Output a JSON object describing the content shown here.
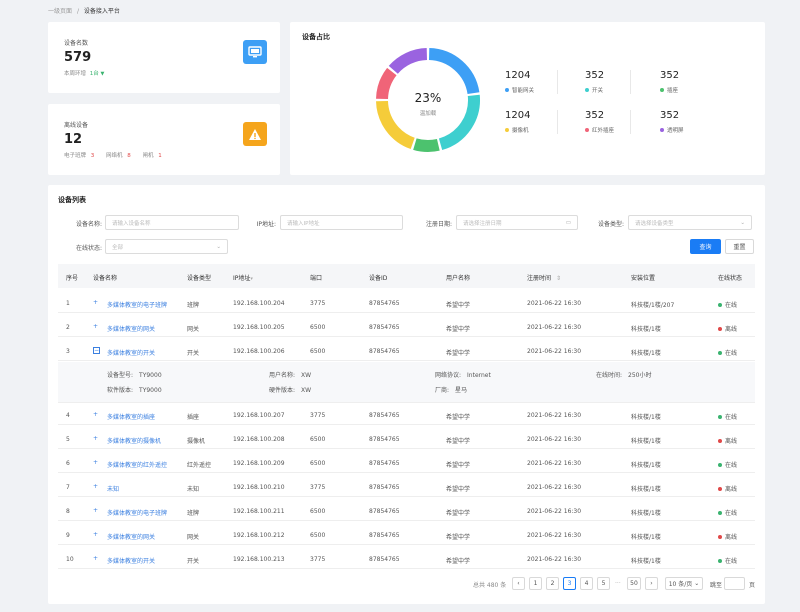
{
  "breadcrumb": {
    "parent": "一级页面",
    "sep": "/",
    "current": "设备接入平台"
  },
  "stat_devices": {
    "label": "设备名数",
    "value": "579",
    "sub_label": "本周环增",
    "sub_value": "1台"
  },
  "stat_offline": {
    "label": "离线设备",
    "value": "12",
    "items": [
      {
        "label": "电子班牌",
        "value": "3"
      },
      {
        "label": "网络机",
        "value": "8"
      },
      {
        "label": "闸机",
        "value": "1"
      }
    ]
  },
  "ratio": {
    "title": "设备占比",
    "percent": "23%",
    "center_label": "温加载",
    "items": [
      {
        "num": "1204",
        "label": "智能网关",
        "color": "#3d9ff5"
      },
      {
        "num": "352",
        "label": "开关",
        "color": "#3ecfcf"
      },
      {
        "num": "352",
        "label": "插座",
        "color": "#4cc26e"
      },
      {
        "num": "1204",
        "label": "摄像机",
        "color": "#f5cc3a"
      },
      {
        "num": "352",
        "label": "红外插座",
        "color": "#f06478"
      },
      {
        "num": "352",
        "label": "透明屏",
        "color": "#9a63e0"
      }
    ],
    "segments": [
      {
        "pct": 23,
        "color": "#3d9ff5"
      },
      {
        "pct": 23,
        "color": "#3ecfcf"
      },
      {
        "pct": 9,
        "color": "#4cc26e"
      },
      {
        "pct": 20,
        "color": "#f5cc3a"
      },
      {
        "pct": 11,
        "color": "#f06478"
      },
      {
        "pct": 14,
        "color": "#9a63e0"
      }
    ]
  },
  "list": {
    "title": "设备列表",
    "filters": {
      "name_label": "设备名称:",
      "name_ph": "请输入设备名称",
      "ip_label": "IP地址:",
      "ip_ph": "请输入IP地址",
      "date_label": "注册日期:",
      "date_ph": "请选择注册日期",
      "type_label": "设备类型:",
      "type_ph": "请选择设备类型",
      "status_label": "在线状态:",
      "status_ph": "全部"
    },
    "query_btn": "查询",
    "reset_btn": "重置",
    "columns": [
      "序号",
      "设备名称",
      "设备类型",
      "IP地址",
      "端口",
      "设备ID",
      "用户名称",
      "注册时间",
      "安装位置",
      "在线状态"
    ],
    "rows": [
      {
        "no": "1",
        "name": "多媒体教室的电子班牌",
        "type": "班牌",
        "ip": "192.168.100.204",
        "port": "3775",
        "id": "87854765",
        "user": "希望中学",
        "time": "2021-06-22 16:30",
        "loc": "科技楼/1楼/207",
        "status": "在线",
        "online": true,
        "expanded": false
      },
      {
        "no": "2",
        "name": "多媒体教室的网关",
        "type": "网关",
        "ip": "192.168.100.205",
        "port": "6500",
        "id": "87854765",
        "user": "希望中学",
        "time": "2021-06-22 16:30",
        "loc": "科技楼/1楼",
        "status": "离线",
        "online": false,
        "expanded": false
      },
      {
        "no": "3",
        "name": "多媒体教室的开关",
        "type": "开关",
        "ip": "192.168.100.206",
        "port": "6500",
        "id": "87854765",
        "user": "希望中学",
        "time": "2021-06-22 16:30",
        "loc": "科技楼/1楼",
        "status": "在线",
        "online": true,
        "expanded": true
      },
      {
        "no": "4",
        "name": "多媒体教室的插座",
        "type": "插座",
        "ip": "192.168.100.207",
        "port": "3775",
        "id": "87854765",
        "user": "希望中学",
        "time": "2021-06-22 16:30",
        "loc": "科技楼/1楼",
        "status": "在线",
        "online": true,
        "expanded": false
      },
      {
        "no": "5",
        "name": "多媒体教室的摄像机",
        "type": "摄像机",
        "ip": "192.168.100.208",
        "port": "6500",
        "id": "87854765",
        "user": "希望中学",
        "time": "2021-06-22 16:30",
        "loc": "科技楼/1楼",
        "status": "离线",
        "online": false,
        "expanded": false
      },
      {
        "no": "6",
        "name": "多媒体教室的红外遥控",
        "type": "红外遥控",
        "ip": "192.168.100.209",
        "port": "6500",
        "id": "87854765",
        "user": "希望中学",
        "time": "2021-06-22 16:30",
        "loc": "科技楼/1楼",
        "status": "在线",
        "online": true,
        "expanded": false
      },
      {
        "no": "7",
        "name": "未知",
        "type": "未知",
        "ip": "192.168.100.210",
        "port": "3775",
        "id": "87854765",
        "user": "希望中学",
        "time": "2021-06-22 16:30",
        "loc": "科技楼/1楼",
        "status": "离线",
        "online": false,
        "expanded": false
      },
      {
        "no": "8",
        "name": "多媒体教室的电子班牌",
        "type": "班牌",
        "ip": "192.168.100.211",
        "port": "6500",
        "id": "87854765",
        "user": "希望中学",
        "time": "2021-06-22 16:30",
        "loc": "科技楼/1楼",
        "status": "在线",
        "online": true,
        "expanded": false
      },
      {
        "no": "9",
        "name": "多媒体教室的网关",
        "type": "网关",
        "ip": "192.168.100.212",
        "port": "6500",
        "id": "87854765",
        "user": "希望中学",
        "time": "2021-06-22 16:30",
        "loc": "科技楼/1楼",
        "status": "离线",
        "online": false,
        "expanded": false
      },
      {
        "no": "10",
        "name": "多媒体教室的开关",
        "type": "开关",
        "ip": "192.168.100.213",
        "port": "3775",
        "id": "87854765",
        "user": "希望中学",
        "time": "2021-06-22 16:30",
        "loc": "科技楼/1楼",
        "status": "在线",
        "online": true,
        "expanded": false
      }
    ],
    "detail": {
      "model_label": "设备型号:",
      "model": "TY9000",
      "user_label": "用户名称:",
      "user": "XW",
      "protocol_label": "网络协议:",
      "protocol": "Internet",
      "online_label": "在线时间:",
      "online": "250小时",
      "fw_label": "软件版本:",
      "fw": "TY9000",
      "hw_label": "硬件版本:",
      "hw": "XW",
      "vendor_label": "厂商:",
      "vendor": "星马"
    },
    "pagination": {
      "total": "总共 480 条",
      "pages": [
        "1",
        "2",
        "3",
        "4",
        "5"
      ],
      "current": "3",
      "ellipsis": "···",
      "last": "50",
      "size": "10 条/页",
      "jump_label": "跳至",
      "jump_unit": "页"
    }
  }
}
